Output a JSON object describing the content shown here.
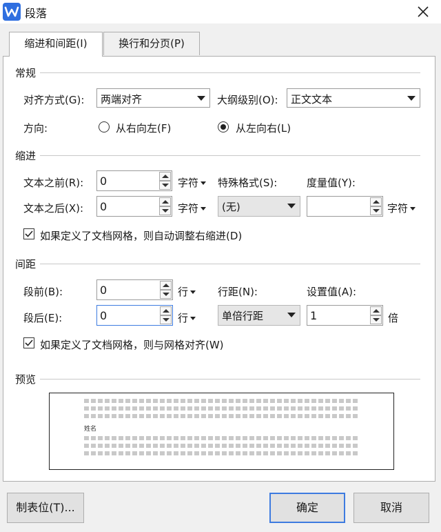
{
  "window": {
    "title": "段落"
  },
  "tabs": [
    {
      "label": "缩进和间距(I)"
    },
    {
      "label": "换行和分页(P)"
    }
  ],
  "general": {
    "heading": "常规",
    "alignment_label": "对齐方式(G):",
    "alignment_value": "两端对齐",
    "outline_label": "大纲级别(O):",
    "outline_value": "正文文本",
    "direction_label": "方向:",
    "rtl_label": "从右向左(F)",
    "ltr_label": "从左向右(L)",
    "direction_selected": "ltr"
  },
  "indent": {
    "heading": "缩进",
    "before_label": "文本之前(R):",
    "before_value": "0",
    "before_unit": "字符",
    "after_label": "文本之后(X):",
    "after_value": "0",
    "after_unit": "字符",
    "special_label": "特殊格式(S):",
    "special_value": "(无)",
    "measure_label": "度量值(Y):",
    "measure_value": "",
    "measure_unit": "字符",
    "auto_adjust_label": "如果定义了文档网格，则自动调整右缩进(D)",
    "auto_adjust_checked": true
  },
  "spacing": {
    "heading": "间距",
    "before_label": "段前(B):",
    "before_value": "0",
    "before_unit": "行",
    "after_label": "段后(E):",
    "after_value": "0",
    "after_unit": "行",
    "line_label": "行距(N):",
    "line_value": "单倍行距",
    "setting_label": "设置值(A):",
    "setting_value": "1",
    "setting_unit": "倍",
    "snap_grid_label": "如果定义了文档网格，则与网格对齐(W)",
    "snap_grid_checked": true
  },
  "preview": {
    "heading": "预览",
    "sample_text": "姓名"
  },
  "buttons": {
    "tabs": "制表位(T)...",
    "ok": "确定",
    "cancel": "取消"
  },
  "colors": {
    "accent": "#3d7be0",
    "app_icon": "#2f6fe0"
  }
}
